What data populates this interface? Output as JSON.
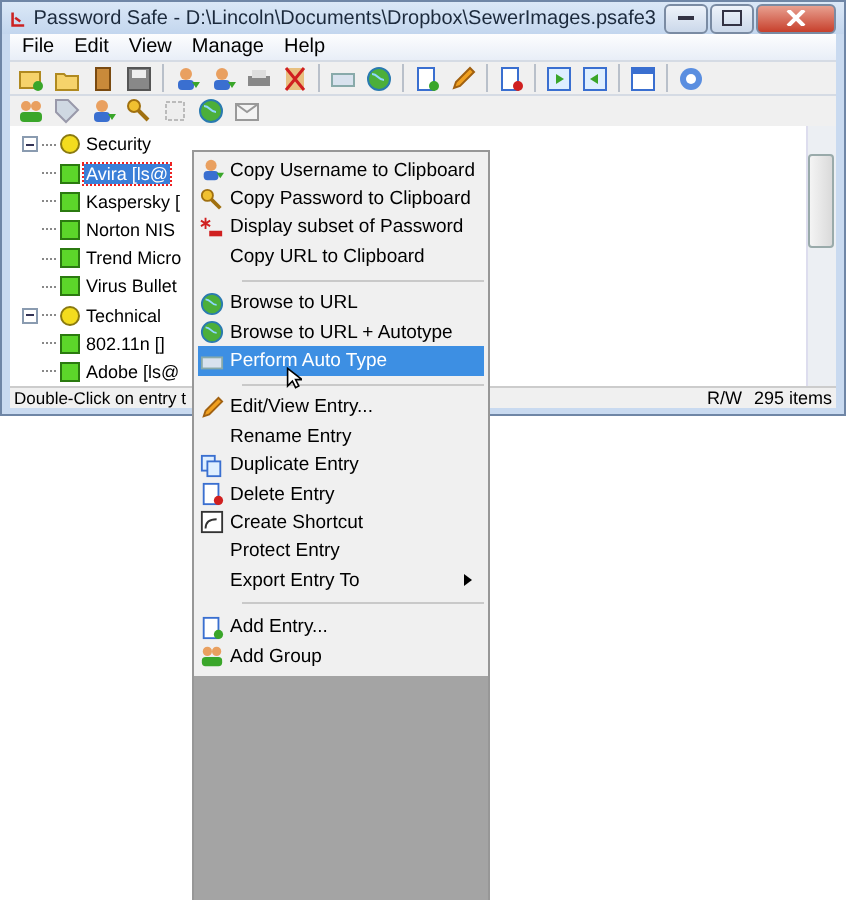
{
  "window": {
    "title": "Password Safe - D:\\Lincoln\\Documents\\Dropbox\\SewerImages.psafe3"
  },
  "menu_bar": [
    "File",
    "Edit",
    "View",
    "Manage",
    "Help"
  ],
  "tree": [
    {
      "label": "Security",
      "expanded": true,
      "children": [
        {
          "label": "Avira [ls@",
          "selected": true
        },
        {
          "label": "Kaspersky [",
          "selected": false
        },
        {
          "label": "Norton NIS",
          "selected": false
        },
        {
          "label": "Trend Micro",
          "selected": false
        },
        {
          "label": "Virus Bullet",
          "selected": false
        }
      ]
    },
    {
      "label": "Technical",
      "expanded": true,
      "children": [
        {
          "label": "802.11n []",
          "selected": false
        },
        {
          "label": "Adobe [ls@",
          "selected": false
        }
      ]
    }
  ],
  "status_bar": {
    "hint": "Double-Click on entry t",
    "mode": "R/W",
    "count": "295 items"
  },
  "context_menu": [
    {
      "kind": "item",
      "label": "Copy Username to Clipboard",
      "selected": false
    },
    {
      "kind": "item",
      "label": "Copy Password to Clipboard",
      "selected": false
    },
    {
      "kind": "item",
      "label": "Display subset of Password",
      "selected": false
    },
    {
      "kind": "item",
      "label": "Copy URL to Clipboard",
      "selected": false
    },
    {
      "kind": "separator"
    },
    {
      "kind": "item",
      "label": "Browse to URL",
      "selected": false
    },
    {
      "kind": "item",
      "label": "Browse to URL + Autotype",
      "selected": false
    },
    {
      "kind": "item",
      "label": "Perform Auto Type",
      "selected": true
    },
    {
      "kind": "separator"
    },
    {
      "kind": "item",
      "label": "Edit/View Entry...",
      "selected": false
    },
    {
      "kind": "item",
      "label": "Rename Entry",
      "selected": false
    },
    {
      "kind": "item",
      "label": "Duplicate Entry",
      "selected": false
    },
    {
      "kind": "item",
      "label": "Delete Entry",
      "selected": false
    },
    {
      "kind": "item",
      "label": "Create Shortcut",
      "selected": false
    },
    {
      "kind": "item",
      "label": "Protect Entry",
      "selected": false
    },
    {
      "kind": "submenu",
      "label": "Export Entry To",
      "selected": false
    },
    {
      "kind": "separator"
    },
    {
      "kind": "item",
      "label": "Add Entry...",
      "selected": false
    },
    {
      "kind": "item",
      "label": "Add Group",
      "selected": false
    }
  ]
}
